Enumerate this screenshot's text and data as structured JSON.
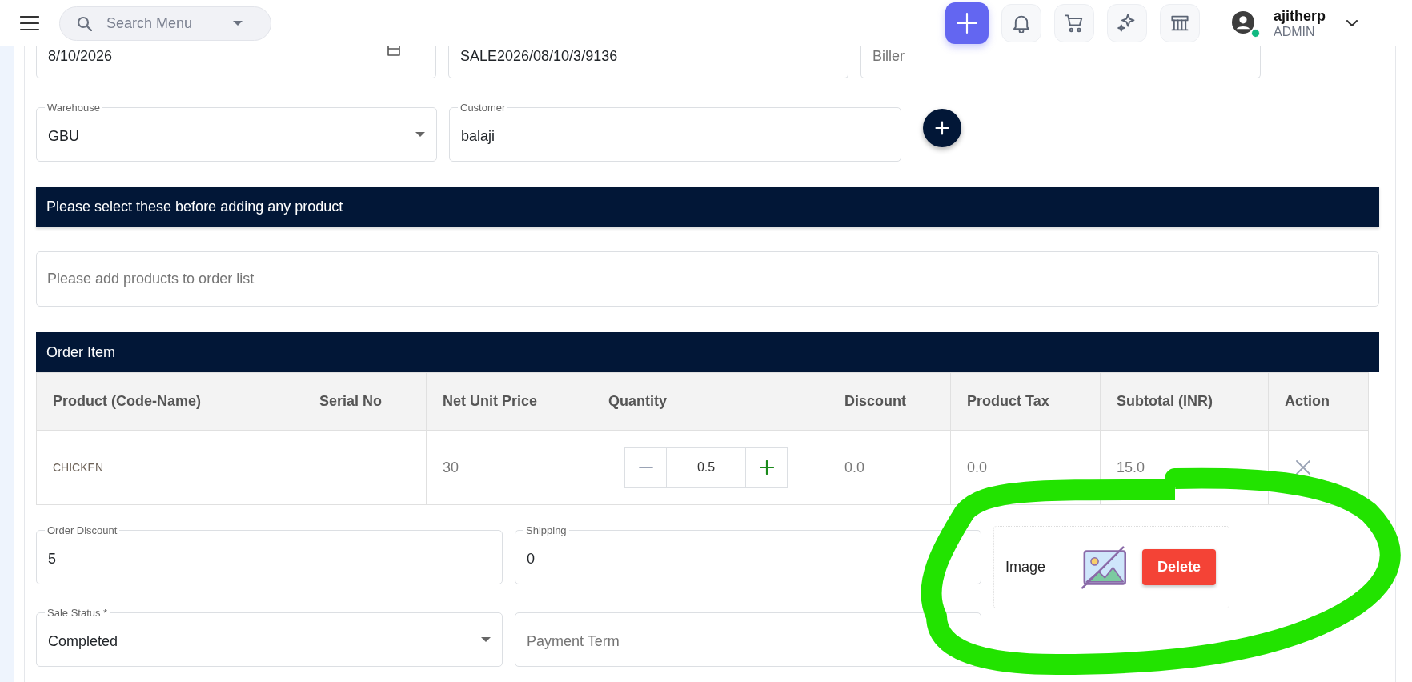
{
  "header": {
    "search": {
      "placeholder": "Search Menu"
    },
    "user": {
      "name": "ajitherp",
      "role": "ADMIN",
      "online": true
    }
  },
  "top_fields": [
    {
      "kind": "date",
      "value": "8/10/2026"
    },
    {
      "kind": "text",
      "value": "SALE2026/08/10/3/9136"
    },
    {
      "kind": "text",
      "placeholder": "Biller"
    }
  ],
  "warehouse": {
    "label": "Warehouse",
    "value": "GBU"
  },
  "customer": {
    "label": "Customer",
    "value": "balaji"
  },
  "notice": "Please select these before adding any product",
  "product_search": {
    "placeholder": "Please add products to order list"
  },
  "order_items": {
    "title": "Order Item",
    "columns": [
      "Product (Code-Name)",
      "Serial No",
      "Net Unit Price",
      "Quantity",
      "Discount",
      "Product Tax",
      "Subtotal (INR)",
      "Action"
    ],
    "rows": [
      {
        "product": "CHICKEN",
        "net_unit_price": "30",
        "quantity": "0.5",
        "discount": "0.0",
        "product_tax": "0.0",
        "subtotal": "15.0"
      }
    ]
  },
  "order_discount": {
    "label": "Order Discount",
    "value": "5"
  },
  "shipping": {
    "label": "Shipping",
    "value": "0"
  },
  "sale_status": {
    "label": "Sale Status *",
    "value": "Completed"
  },
  "payment_term": {
    "placeholder": "Payment Term"
  },
  "image": {
    "label": "Image",
    "button": "Delete"
  }
}
